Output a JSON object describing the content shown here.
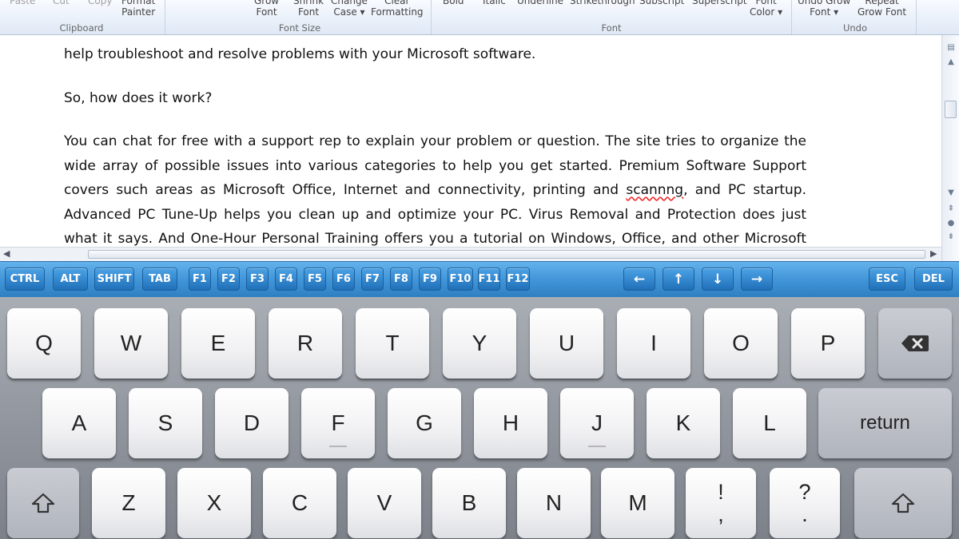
{
  "ribbon": {
    "buttons": [
      {
        "label": "Paste",
        "dim": true
      },
      {
        "label": "Cut",
        "dim": true
      },
      {
        "label": "Copy",
        "dim": true
      },
      {
        "label": "Format\nPainter",
        "dim": false
      },
      {
        "label": "Grow\nFont",
        "dim": false
      },
      {
        "label": "Shrink\nFont",
        "dim": false
      },
      {
        "label": "Change\nCase ▾",
        "dim": false
      },
      {
        "label": "Clear\nFormatting",
        "dim": false
      },
      {
        "label": "Bold",
        "dim": false
      },
      {
        "label": "Italic",
        "dim": false
      },
      {
        "label": "Underline",
        "dim": false
      },
      {
        "label": "Strikethrough",
        "dim": false
      },
      {
        "label": "Subscript",
        "dim": false
      },
      {
        "label": "Superscript",
        "dim": false
      },
      {
        "label": "Font\nColor ▾",
        "dim": false
      },
      {
        "label": "Undo Grow\nFont ▾",
        "dim": false
      },
      {
        "label": "Repeat\nGrow Font",
        "dim": false
      }
    ],
    "groups": [
      "Clipboard",
      "Font Size",
      "Font",
      "Undo"
    ]
  },
  "document": {
    "paragraphs": [
      "help troubleshoot and resolve problems with your Microsoft software.",
      "So, how does it work?"
    ],
    "para3": {
      "before": "You can chat for free with a support rep to explain your problem or question. The site tries to organize the wide array of possible issues into various categories to help you get started. Premium Software Support covers such areas as Microsoft Office, Internet and connectivity, printing and ",
      "misspelled": "scannng",
      "after": ", and PC startup. Advanced PC Tune-Up helps you clean up and optimize your PC. Virus Removal and Protection does just what it says. And One-Hour Personal Training offers you a tutorial on Windows, Office, and other Microsoft programs."
    }
  },
  "function_keys": {
    "left": [
      "CTRL",
      "ALT",
      "SHIFT",
      "TAB",
      "F1",
      "F2",
      "F3",
      "F4",
      "F5",
      "F6",
      "F7",
      "F8",
      "F9",
      "F10",
      "F11",
      "F12"
    ],
    "arrows": [
      "←",
      "↑",
      "↓",
      "→"
    ],
    "right": [
      "ESC",
      "DEL"
    ]
  },
  "keyboard": {
    "row1": [
      "Q",
      "W",
      "E",
      "R",
      "T",
      "Y",
      "U",
      "I",
      "O",
      "P"
    ],
    "backspace_icon": "backspace-icon",
    "row2": [
      "A",
      "S",
      "D",
      "F",
      "G",
      "H",
      "J",
      "K",
      "L"
    ],
    "return_label": "return",
    "shift_icon": "shift-icon",
    "row3": [
      "Z",
      "X",
      "C",
      "V",
      "B",
      "N",
      "M"
    ],
    "punct1": {
      "top": "!",
      "bottom": ","
    },
    "punct2": {
      "top": "?",
      "bottom": "."
    }
  },
  "colors": {
    "function_bar": "#3f93d6",
    "keyboard_bg": "#8d9199",
    "spell_underline": "#e33333"
  }
}
